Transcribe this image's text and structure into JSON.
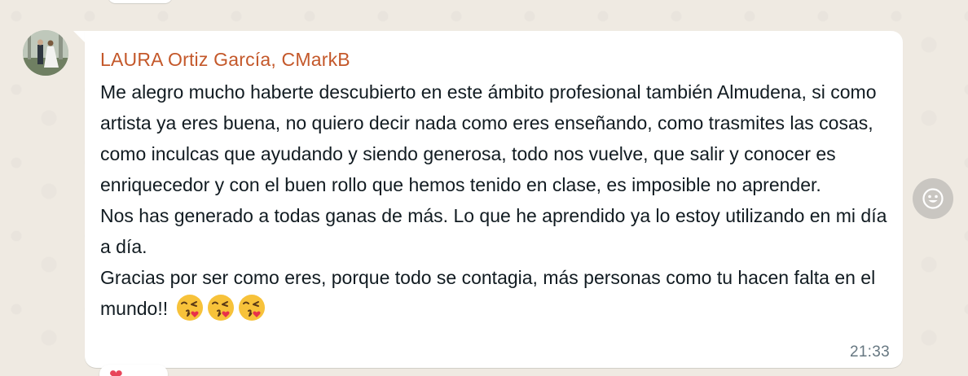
{
  "message": {
    "sender": "LAURA Ortiz García, CMarkB",
    "sender_color": "#c4582a",
    "lines": [
      "Me alegro mucho haberte descubierto en este ámbito profesional también Almudena, si como artista ya eres buena, no quiero decir nada como eres enseñando, como trasmites las cosas, como inculcas que ayudando y siendo generosa, todo nos vuelve, que salir y conocer es enriquecedor y con el buen rollo que hemos tenido en clase, es imposible no aprender.",
      "Nos has generado a todas ganas de más. Lo que he aprendido ya lo estoy utilizando en mi día a día.",
      "Gracias por ser como eres, porque todo se contagia, más personas como tu hacen falta en el mundo!!"
    ],
    "emojis": [
      "face-blowing-a-kiss",
      "face-blowing-a-kiss",
      "face-blowing-a-kiss"
    ],
    "timestamp": "21:33"
  },
  "icons": {
    "react": "smiley-icon",
    "reaction_peek": "heart-icon"
  },
  "reaction_peek_text": "❤"
}
